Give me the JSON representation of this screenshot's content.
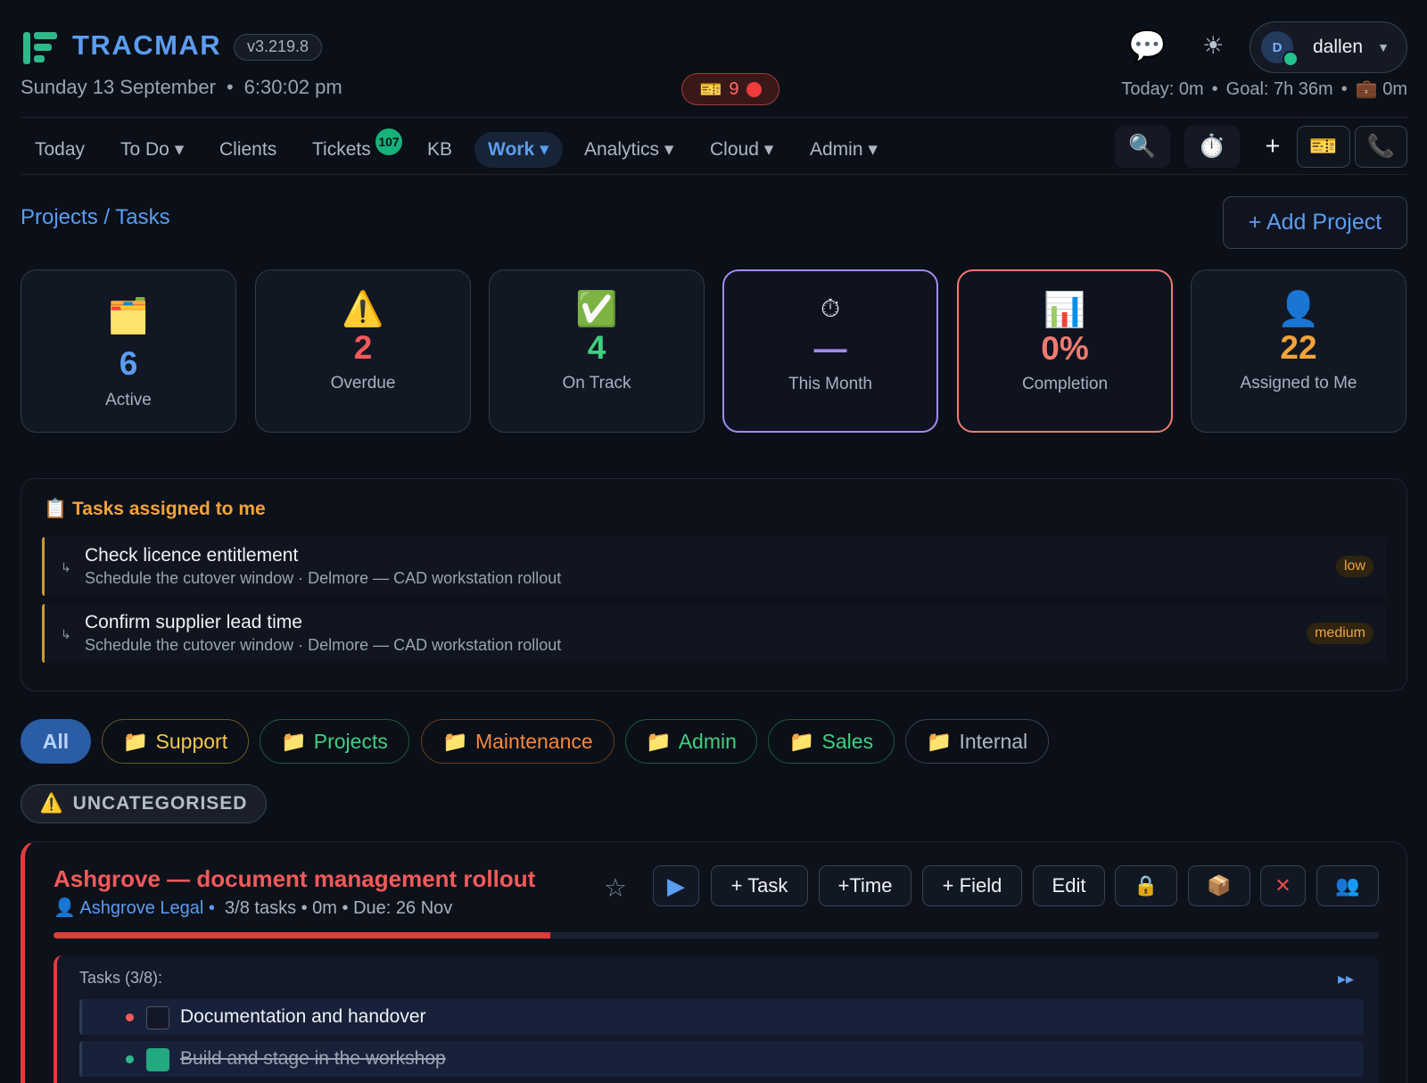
{
  "header": {
    "brand": "TRACMAR",
    "version": "v3.219.8",
    "date": "Sunday 13 September",
    "time": "6:30:02 pm",
    "ticket_alert_count": "9",
    "user": {
      "initial": "D",
      "name": "dallen"
    },
    "today": "Today: 0m",
    "goal": "Goal: 7h 36m",
    "briefcase": "0m",
    "icons": {
      "chat": "chat-bubble-icon",
      "theme": "sun-icon",
      "ticket": "ticket-icon",
      "briefcase": "briefcase-icon"
    },
    "accent": "#5b9df0"
  },
  "nav": {
    "items": [
      {
        "label": "Today"
      },
      {
        "label": "To Do ▾"
      },
      {
        "label": "Clients"
      },
      {
        "label": "Tickets"
      },
      {
        "label": "KB"
      },
      {
        "label": "Work ▾"
      },
      {
        "label": "Analytics ▾"
      },
      {
        "label": "Cloud ▾"
      },
      {
        "label": "Admin ▾"
      }
    ],
    "active": "Work",
    "tickets_badge": "107",
    "tools": [
      "search-icon",
      "stopwatch-icon",
      "plus-icon",
      "ticket-icon",
      "phone-icon"
    ]
  },
  "page": {
    "breadcrumb": "Projects / Tasks",
    "add_project": "+ Add Project"
  },
  "stats": [
    {
      "icon": "🗂️",
      "value": "6",
      "label": "Active",
      "color": "#5b9df0"
    },
    {
      "icon": "⚠️",
      "value": "2",
      "label": "Overdue",
      "color": "#f25a5a"
    },
    {
      "icon": "✅",
      "value": "4",
      "label": "On Track",
      "color": "#3fd07f"
    },
    {
      "icon": "⏱",
      "value": "—",
      "label": "This Month",
      "color": "#a48bf2"
    },
    {
      "icon": "📊",
      "value": "0%",
      "label": "Completion",
      "color": "#f07a6e"
    },
    {
      "icon": "👤",
      "value": "22",
      "label": "Assigned to Me",
      "color": "#f2a33a"
    }
  ],
  "assigned": {
    "title": "Tasks assigned to me",
    "items": [
      {
        "title": "Check licence entitlement",
        "subtitle": "Schedule the cutover window · Delmore — CAD workstation rollout",
        "priority": "low"
      },
      {
        "title": "Confirm supplier lead time",
        "subtitle": "Schedule the cutover window · Delmore — CAD workstation rollout",
        "priority": "medium"
      }
    ]
  },
  "filters": {
    "chips": [
      "All",
      "Support",
      "Projects",
      "Maintenance",
      "Admin",
      "Sales",
      "Internal"
    ],
    "selected": "All",
    "group_label": "UNCATEGORISED"
  },
  "project": {
    "title": "Ashgrove — document management rollout",
    "client": "Ashgrove Legal",
    "summary": "3/8 tasks • 0m • Due: 26 Nov",
    "progress": 0.375,
    "buttons": {
      "task": "+ Task",
      "time": "+Time",
      "field": "+ Field",
      "edit": "Edit",
      "close": "✕"
    },
    "tasks_label": "Tasks (3/8):",
    "tasks": [
      {
        "title": "Documentation and handover",
        "done": false
      },
      {
        "title": "Build and stage in the workshop",
        "done": true
      }
    ],
    "status_color": "#e23b3b"
  }
}
